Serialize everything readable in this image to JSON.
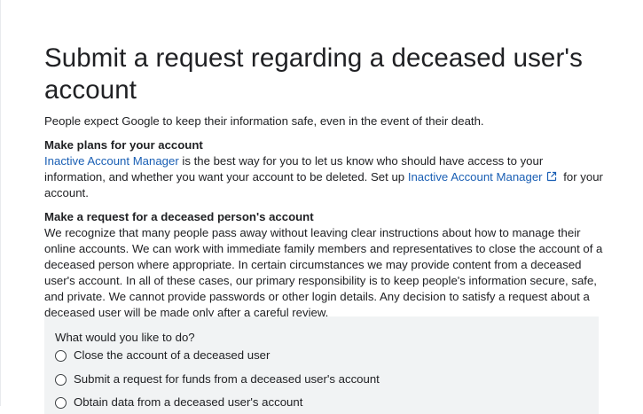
{
  "page": {
    "title": "Submit a request regarding a deceased user's account",
    "intro": "People expect Google to keep their information safe, even in the event of their death."
  },
  "plans": {
    "heading": "Make plans for your account",
    "link1": "Inactive Account Manager",
    "text1": " is the best way for you to let us know who should have access to your information, and whether you want your account to be deleted. Set up ",
    "link2": "Inactive Account Manager",
    "text2": " for your account."
  },
  "request": {
    "heading": "Make a request for a deceased person's account",
    "body": "We recognize that many people pass away without leaving clear instructions about how to manage their online accounts. We can work with immediate family members and representatives to close the account of a deceased person where appropriate. In certain circumstances we may provide content from a deceased user's account. In all of these cases, our primary responsibility is to keep people's information secure, safe, and private. We cannot provide passwords or other login details. Any decision to satisfy a request about a deceased user will be made only after a careful review."
  },
  "form": {
    "question": "What would you like to do?",
    "options": [
      "Close the account of a deceased user",
      "Submit a request for funds from a deceased user's account",
      "Obtain data from a deceased user's account"
    ]
  },
  "colors": {
    "link": "#1a5fb4",
    "card_bg": "#f1f3f4",
    "text": "#202124"
  },
  "icons": {
    "external_link": "open-in-new-icon"
  }
}
